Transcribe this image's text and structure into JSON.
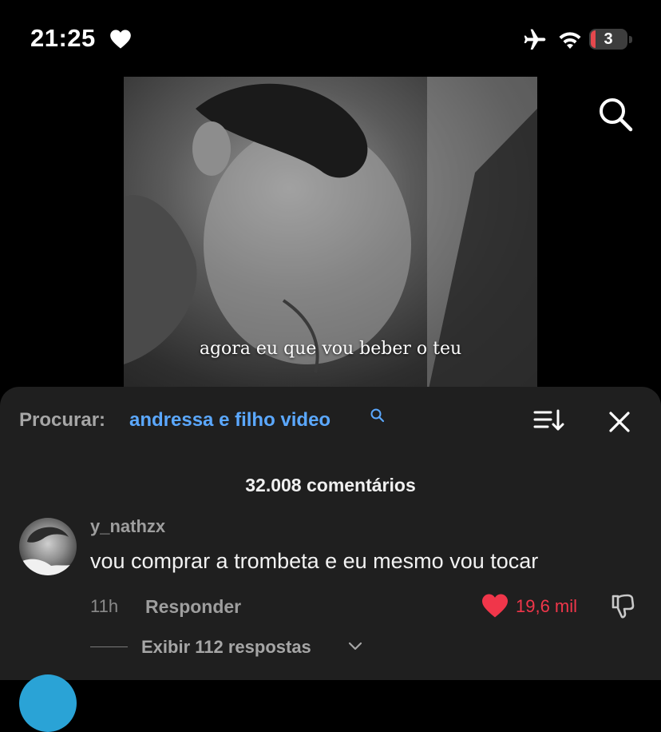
{
  "status_bar": {
    "time": "21:25",
    "battery_level": "3",
    "icons": [
      "heart-icon",
      "airplane-icon",
      "wifi-icon",
      "battery-icon"
    ]
  },
  "video": {
    "caption": "agora eu que vou beber o teu"
  },
  "comments_panel": {
    "search_label": "Procurar:",
    "search_term": "andressa e filho video",
    "comment_count": "32.008 comentários",
    "comments": [
      {
        "username": "y_nathzx",
        "text": "vou comprar a trombeta e eu mesmo vou tocar",
        "time_ago": "11h",
        "reply_label": "Responder",
        "likes": "19,6 mil",
        "view_replies": "Exibir 112 respostas"
      }
    ]
  },
  "colors": {
    "background": "#000000",
    "sheet": "#1f1f1f",
    "search_term": "#5ba8ff",
    "like": "#f0364a"
  }
}
